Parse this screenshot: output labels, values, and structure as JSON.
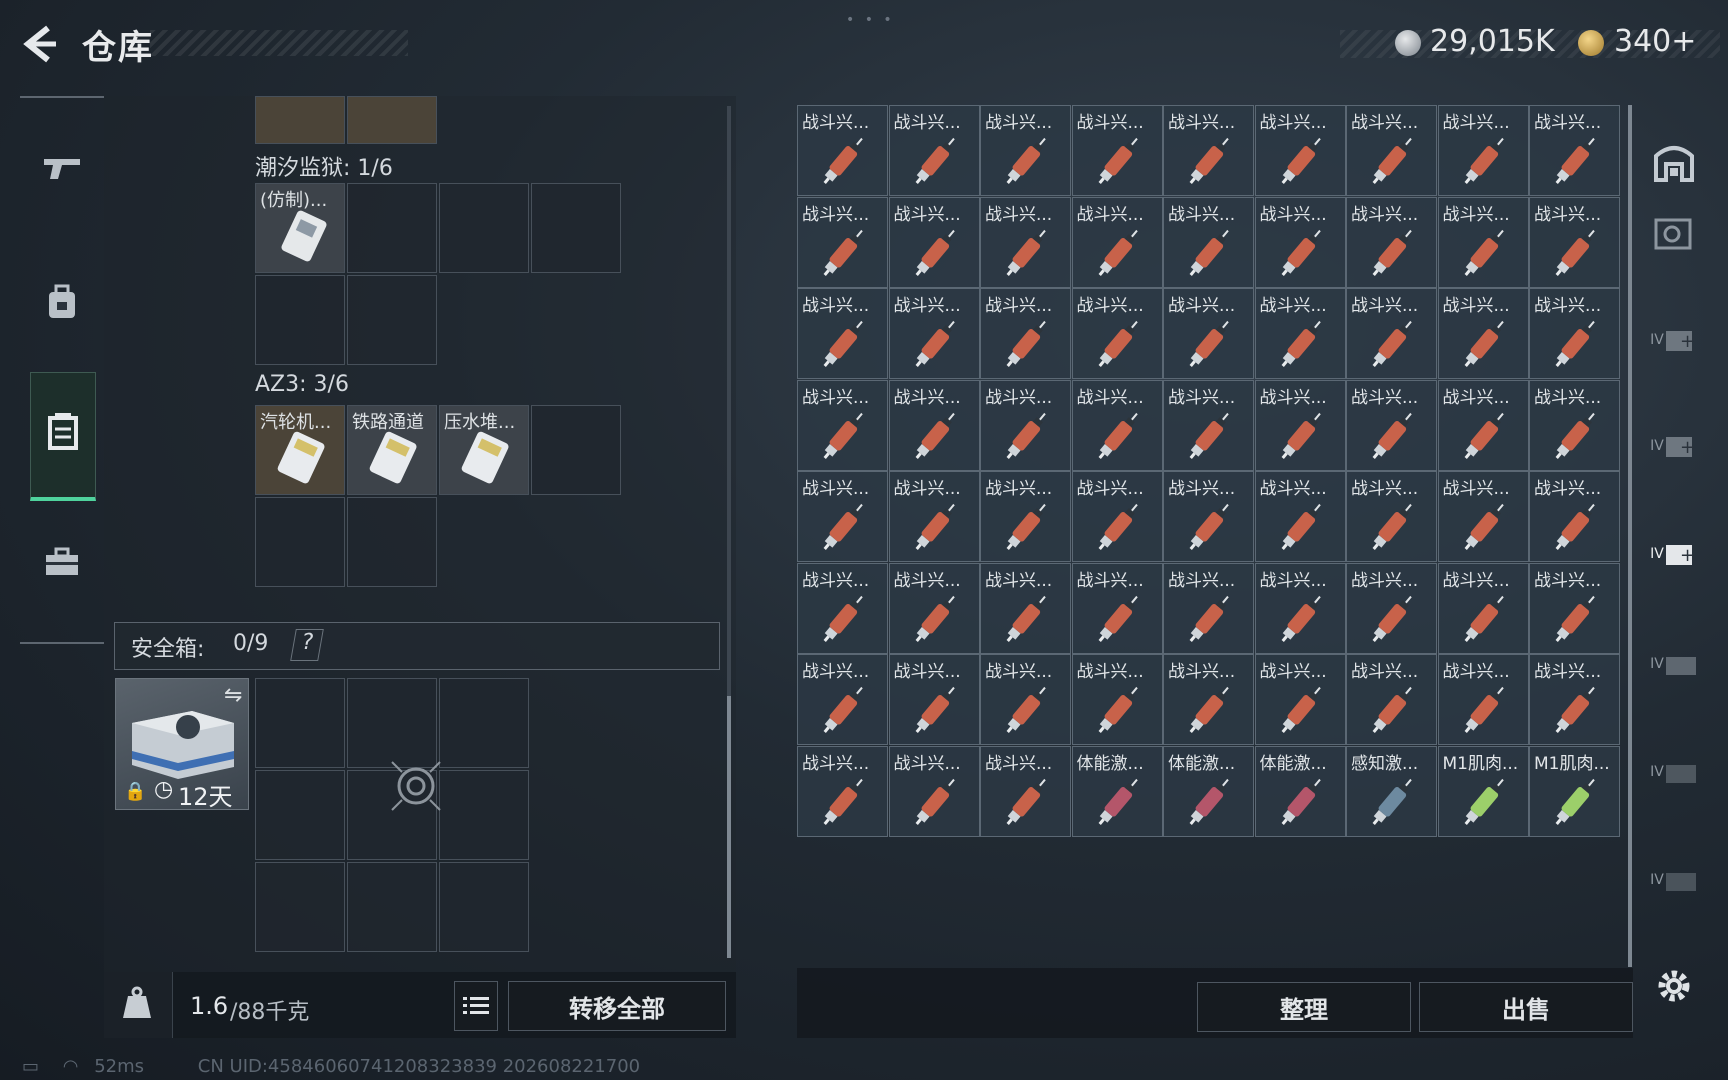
{
  "header": {
    "title": "仓库",
    "money": "29,015K",
    "coins": "340+",
    "tiny_text": ""
  },
  "containers": [
    {
      "name": "潮汐监狱",
      "count": "1/6",
      "items": [
        {
          "label": "(仿制)..."
        }
      ]
    },
    {
      "name": "AZ3",
      "count": "3/6",
      "items": [
        {
          "label": "汽轮机..."
        },
        {
          "label": "铁路通道"
        },
        {
          "label": "压水堆..."
        }
      ]
    }
  ],
  "safe_box": {
    "label": "安全箱:",
    "count": "0/9",
    "help": "?",
    "days": "12天"
  },
  "weight": {
    "current": "1.6",
    "max": "/88千克"
  },
  "buttons": {
    "transfer_all": "转移全部",
    "sort": "整理",
    "sell": "出售"
  },
  "grid_items": [
    "战斗兴...",
    "战斗兴...",
    "战斗兴...",
    "战斗兴...",
    "战斗兴...",
    "战斗兴...",
    "战斗兴...",
    "战斗兴...",
    "战斗兴...",
    "战斗兴...",
    "战斗兴...",
    "战斗兴...",
    "战斗兴...",
    "战斗兴...",
    "战斗兴...",
    "战斗兴...",
    "战斗兴...",
    "战斗兴...",
    "战斗兴...",
    "战斗兴...",
    "战斗兴...",
    "战斗兴...",
    "战斗兴...",
    "战斗兴...",
    "战斗兴...",
    "战斗兴...",
    "战斗兴...",
    "战斗兴...",
    "战斗兴...",
    "战斗兴...",
    "战斗兴...",
    "战斗兴...",
    "战斗兴...",
    "战斗兴...",
    "战斗兴...",
    "战斗兴...",
    "战斗兴...",
    "战斗兴...",
    "战斗兴...",
    "战斗兴...",
    "战斗兴...",
    "战斗兴...",
    "战斗兴...",
    "战斗兴...",
    "战斗兴...",
    "战斗兴...",
    "战斗兴...",
    "战斗兴...",
    "战斗兴...",
    "战斗兴...",
    "战斗兴...",
    "战斗兴...",
    "战斗兴...",
    "战斗兴...",
    "战斗兴...",
    "战斗兴...",
    "战斗兴...",
    "战斗兴...",
    "战斗兴...",
    "战斗兴...",
    "战斗兴...",
    "战斗兴...",
    "战斗兴...",
    "战斗兴...",
    "战斗兴...",
    "战斗兴...",
    "体能激...",
    "体能激...",
    "体能激...",
    "感知激...",
    "M1肌肉...",
    "M1肌肉..."
  ],
  "grid_colors": {
    "combat": "#c8624a",
    "stamina": "#b4566a",
    "sense": "#6d8aa0",
    "m1": "#9ccf6a"
  },
  "status": {
    "ping": "52ms",
    "uid": "CN UID:4584606074120832383​9 202608221700"
  },
  "right_nav": [
    "IV",
    "IV",
    "IV",
    "IV",
    "IV",
    "IV"
  ]
}
